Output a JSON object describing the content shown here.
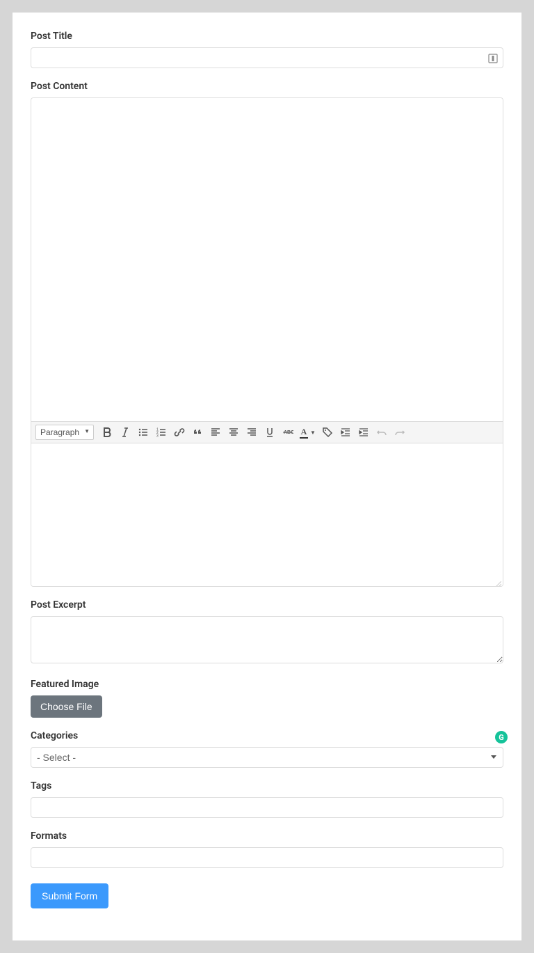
{
  "fields": {
    "title_label": "Post Title",
    "content_label": "Post Content",
    "excerpt_label": "Post Excerpt",
    "featured_label": "Featured Image",
    "categories_label": "Categories",
    "tags_label": "Tags",
    "formats_label": "Formats"
  },
  "title_value": "",
  "excerpt_value": "",
  "tags_value": "",
  "formats_value": "",
  "editor": {
    "format_selector": "Paragraph",
    "toolbar": {
      "bold": "Bold",
      "italic": "Italic",
      "bullist": "Bulleted list",
      "numlist": "Numbered list",
      "link": "Insert link",
      "blockquote": "Blockquote",
      "alignleft": "Align left",
      "aligncenter": "Align center",
      "alignright": "Align right",
      "underline": "Underline",
      "strike": "Strikethrough",
      "textcolor": "Text color",
      "tag": "Tag",
      "outdent": "Decrease indent",
      "indent": "Increase indent",
      "undo": "Undo",
      "redo": "Redo"
    }
  },
  "categories_placeholder": "- Select -",
  "buttons": {
    "choose_file": "Choose File",
    "submit": "Submit Form"
  },
  "grammarly": "G"
}
